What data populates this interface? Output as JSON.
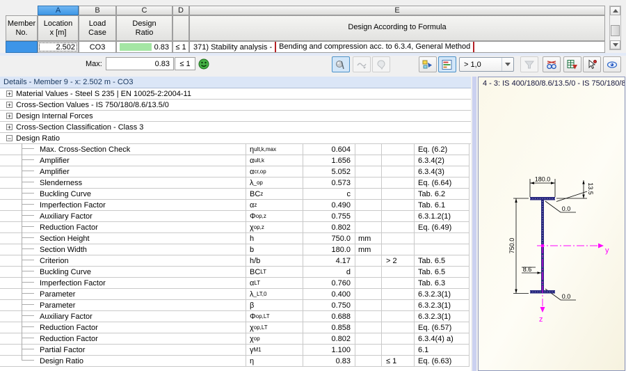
{
  "top_table": {
    "corner": {
      "line1": "Member",
      "line2": "No."
    },
    "columns": [
      {
        "letter": "A",
        "header1": "Location",
        "header2": "x [m]"
      },
      {
        "letter": "B",
        "header1": "Load",
        "header2": "Case"
      },
      {
        "letter": "C",
        "header1": "Design",
        "header2": "Ratio"
      },
      {
        "letter": "D",
        "header1": "",
        "header2": ""
      },
      {
        "letter": "E",
        "header": "Design According to Formula"
      }
    ],
    "row": {
      "location": "2.502",
      "load_case": "CO3",
      "design_ratio": "0.83",
      "limit": "≤ 1",
      "formula_prefix": "371) Stability analysis -",
      "formula_highlight": "Bending and compression acc. to 6.3.4, General Method"
    }
  },
  "toolbar": {
    "max_label": "Max:",
    "max_value": "0.83",
    "max_limit": "≤ 1",
    "threshold_value": "> 1,0"
  },
  "details": {
    "title": "Details - Member 9 - x: 2.502 m - CO3",
    "sections": [
      {
        "toggle": "+",
        "label": "Material Values - Steel S 235 | EN 10025-2:2004-11"
      },
      {
        "toggle": "+",
        "label": "Cross-Section Values  -  IS 750/180/8.6/13.5/0"
      },
      {
        "toggle": "+",
        "label": "Design Internal Forces"
      },
      {
        "toggle": "+",
        "label": "Cross-Section Classification - Class 3"
      },
      {
        "toggle": "−",
        "label": "Design Ratio"
      }
    ],
    "rows": [
      {
        "label": "Max. Cross-Section Check",
        "sym": "η",
        "sub": "ult,k,max",
        "value": "0.604",
        "unit": "",
        "crit": "",
        "ref": "Eq. (6.2)"
      },
      {
        "label": "Amplifier",
        "sym": "α",
        "sub": "ult,k",
        "value": "1.656",
        "unit": "",
        "crit": "",
        "ref": "6.3.4(2)"
      },
      {
        "label": "Amplifier",
        "sym": "α",
        "sub": "cr,op",
        "value": "5.052",
        "unit": "",
        "crit": "",
        "ref": "6.3.4(3)"
      },
      {
        "label": "Slenderness",
        "sym": "λ",
        "sub": "_op",
        "value": "0.573",
        "unit": "",
        "crit": "",
        "ref": "Eq. (6.64)"
      },
      {
        "label": "Buckling Curve",
        "sym": "BC",
        "sub": "z",
        "value": "c",
        "unit": "",
        "crit": "",
        "ref": "Tab. 6.2"
      },
      {
        "label": "Imperfection Factor",
        "sym": "α",
        "sub": "z",
        "value": "0.490",
        "unit": "",
        "crit": "",
        "ref": "Tab. 6.1"
      },
      {
        "label": "Auxiliary Factor",
        "sym": "Φ",
        "sub": "op,z",
        "value": "0.755",
        "unit": "",
        "crit": "",
        "ref": "6.3.1.2(1)"
      },
      {
        "label": "Reduction Factor",
        "sym": "χ",
        "sub": "op,z",
        "value": "0.802",
        "unit": "",
        "crit": "",
        "ref": "Eq. (6.49)"
      },
      {
        "label": "Section Height",
        "sym": "h",
        "sub": "",
        "value": "750.0",
        "unit": "mm",
        "crit": "",
        "ref": ""
      },
      {
        "label": "Section Width",
        "sym": "b",
        "sub": "",
        "value": "180.0",
        "unit": "mm",
        "crit": "",
        "ref": ""
      },
      {
        "label": "Criterion",
        "sym": "h/b",
        "sub": "",
        "value": "4.17",
        "unit": "",
        "crit": "> 2",
        "ref": "Tab. 6.5"
      },
      {
        "label": "Buckling Curve",
        "sym": "BC",
        "sub": "LT",
        "value": "d",
        "unit": "",
        "crit": "",
        "ref": "Tab. 6.5"
      },
      {
        "label": "Imperfection Factor",
        "sym": "α",
        "sub": "LT",
        "value": "0.760",
        "unit": "",
        "crit": "",
        "ref": "Tab. 6.3"
      },
      {
        "label": "Parameter",
        "sym": "λ",
        "sub": "_LT,0",
        "value": "0.400",
        "unit": "",
        "crit": "",
        "ref": "6.3.2.3(1)"
      },
      {
        "label": "Parameter",
        "sym": "β",
        "sub": "",
        "value": "0.750",
        "unit": "",
        "crit": "",
        "ref": "6.3.2.3(1)"
      },
      {
        "label": "Auxiliary Factor",
        "sym": "Φ",
        "sub": "op,LT",
        "value": "0.688",
        "unit": "",
        "crit": "",
        "ref": "6.3.2.3(1)"
      },
      {
        "label": "Reduction Factor",
        "sym": "χ",
        "sub": "op,LT",
        "value": "0.858",
        "unit": "",
        "crit": "",
        "ref": "Eq. (6.57)"
      },
      {
        "label": "Reduction Factor",
        "sym": "χ",
        "sub": "op",
        "value": "0.802",
        "unit": "",
        "crit": "",
        "ref": "6.3.4(4) a)"
      },
      {
        "label": "Partial Factor",
        "sym": "γ",
        "sub": "M1",
        "value": "1.100",
        "unit": "",
        "crit": "",
        "ref": "6.1"
      },
      {
        "label": "Design Ratio",
        "sym": "η",
        "sub": "",
        "value": "0.83",
        "unit": "",
        "crit": "≤ 1",
        "ref": "Eq. (6.63)"
      }
    ]
  },
  "section_panel": {
    "title": "4 - 3: IS 400/180/8.6/13.5/0 - IS 750/180/8.",
    "dims": {
      "width": "180.0",
      "flange_thk": "13.5",
      "height": "750.0",
      "web_thk": "8.6",
      "radius_top": "0.0",
      "radius_bottom": "0.0",
      "axis_y": "y",
      "axis_z": "z"
    }
  },
  "colors": {
    "selection_blue": "#3D95E8",
    "ratio_green": "#A4E6A4",
    "highlight_red": "#B42025",
    "details_title_bg": "#DBE6F7",
    "panel_cream": "#FBF8E9",
    "section_navy": "#26267E",
    "axis_magenta": "#FF00FF",
    "ok_green": "#3DA43D"
  }
}
